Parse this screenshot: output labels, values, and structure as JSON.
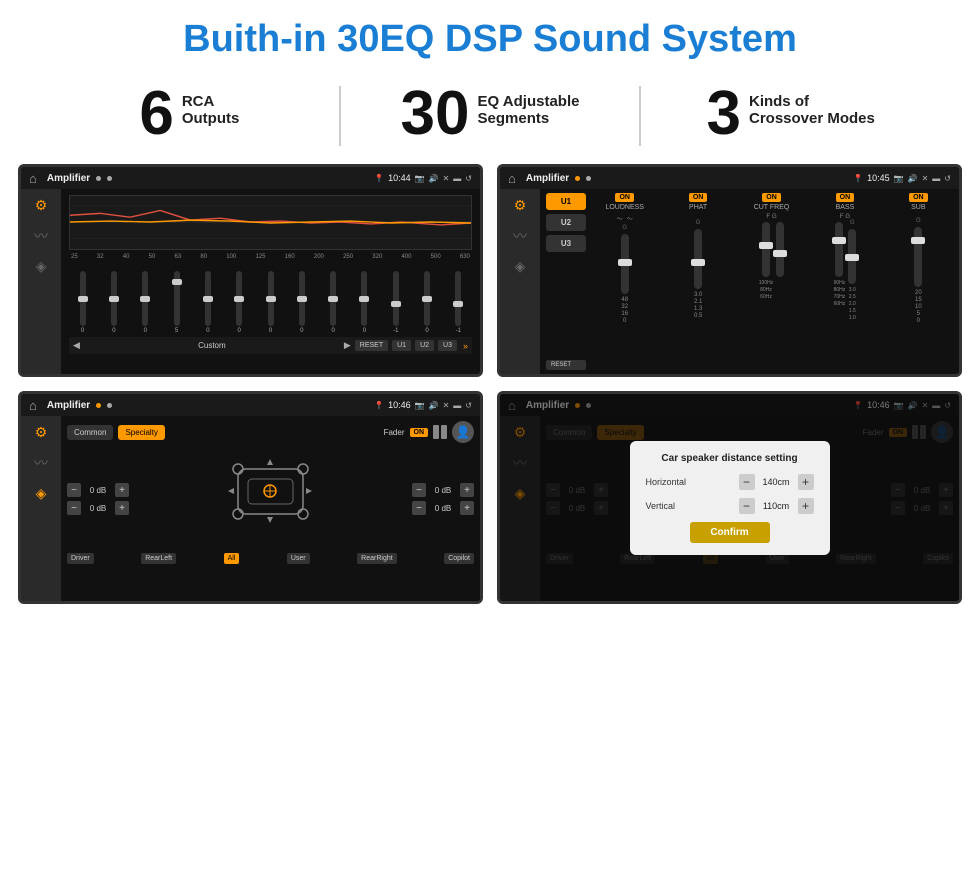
{
  "page": {
    "title": "Buith-in 30EQ DSP Sound System",
    "background": "#ffffff"
  },
  "stats": [
    {
      "number": "6",
      "line1": "RCA",
      "line2": "Outputs"
    },
    {
      "number": "30",
      "line1": "EQ Adjustable",
      "line2": "Segments"
    },
    {
      "number": "3",
      "line1": "Kinds of",
      "line2": "Crossover Modes"
    }
  ],
  "screens": [
    {
      "id": "eq-screen",
      "title": "Amplifier",
      "time": "10:44",
      "type": "equalizer"
    },
    {
      "id": "crossover-screen",
      "title": "Amplifier",
      "time": "10:45",
      "type": "crossover"
    },
    {
      "id": "fader-screen",
      "title": "Amplifier",
      "time": "10:46",
      "type": "fader"
    },
    {
      "id": "dialog-screen",
      "title": "Amplifier",
      "time": "10:46",
      "type": "dialog"
    }
  ],
  "eq": {
    "frequencies": [
      "25",
      "32",
      "40",
      "50",
      "63",
      "80",
      "100",
      "125",
      "160",
      "200",
      "250",
      "320",
      "400",
      "500",
      "630"
    ],
    "values": [
      "0",
      "0",
      "0",
      "5",
      "0",
      "0",
      "0",
      "0",
      "0",
      "0",
      "-1",
      "0",
      "-1"
    ],
    "preset": "Custom",
    "buttons": [
      "RESET",
      "U1",
      "U2",
      "U3"
    ]
  },
  "crossover": {
    "presets": [
      "U1",
      "U2",
      "U3"
    ],
    "channels": [
      {
        "name": "LOUDNESS",
        "on": true
      },
      {
        "name": "PHAT",
        "on": true
      },
      {
        "name": "CUT FREQ",
        "on": true
      },
      {
        "name": "BASS",
        "on": true
      },
      {
        "name": "SUB",
        "on": true
      }
    ],
    "reset_label": "RESET"
  },
  "fader": {
    "tabs": [
      "Common",
      "Specialty"
    ],
    "active_tab": 1,
    "fader_label": "Fader",
    "on_label": "ON",
    "controls": [
      {
        "label": "0 dB"
      },
      {
        "label": "0 dB"
      },
      {
        "label": "0 dB"
      },
      {
        "label": "0 dB"
      }
    ],
    "buttons": [
      "Driver",
      "RearLeft",
      "All",
      "User",
      "RearRight",
      "Copilot"
    ]
  },
  "dialog": {
    "title": "Car speaker distance setting",
    "fields": [
      {
        "label": "Horizontal",
        "value": "140cm"
      },
      {
        "label": "Vertical",
        "value": "110cm"
      }
    ],
    "confirm_label": "Confirm",
    "tabs": [
      "Common",
      "Specialty"
    ],
    "fader_label": "Fader",
    "on_label": "ON",
    "buttons": [
      "Driver",
      "RearLeft",
      "All",
      "User",
      "RearRight",
      "Copilot"
    ]
  }
}
